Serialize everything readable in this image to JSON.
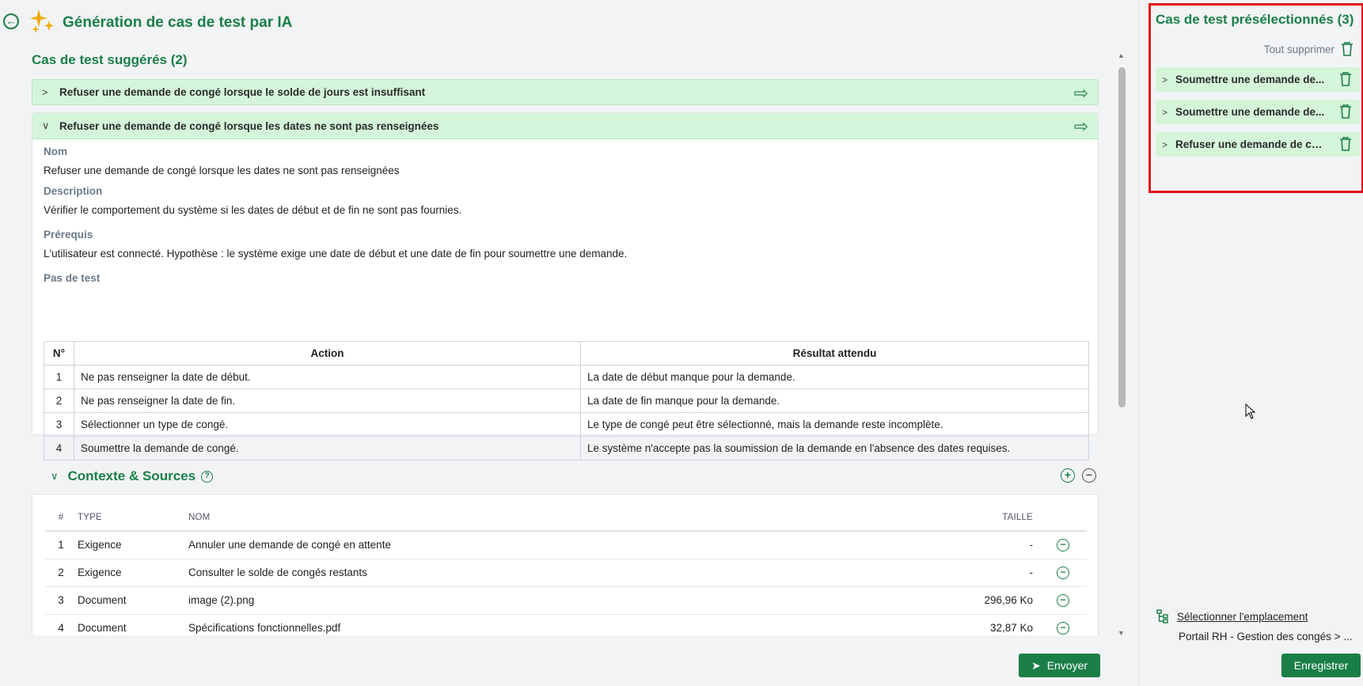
{
  "header": {
    "title": "Génération de cas de test par IA",
    "back_icon": "arrow-left-circle-icon",
    "logo_icon": "sparkle-stars-icon"
  },
  "suggested": {
    "title": "Cas de test suggérés (2)",
    "items": [
      {
        "label": "Refuser une demande de congé lorsque le solde de jours est insuffisant",
        "expanded": false
      },
      {
        "label": "Refuser une demande de congé lorsque les dates ne sont pas renseignées",
        "expanded": true
      }
    ],
    "detail": {
      "name_label": "Nom",
      "name_value": "Refuser une demande de congé lorsque les dates ne sont pas renseignées",
      "description_label": "Description",
      "description_value": "Vérifier le comportement du système si les dates de début et de fin ne sont pas fournies.",
      "prereq_label": "Prérequis",
      "prereq_value": "L'utilisateur est connecté. Hypothèse : le système exige une date de début et une date de fin pour soumettre une demande.",
      "steps_label": "Pas de test",
      "steps_headers": [
        "N°",
        "Action",
        "Résultat attendu"
      ],
      "steps": [
        {
          "n": "1",
          "action": "Ne pas renseigner la date de début.",
          "result": "La date de début manque pour la demande."
        },
        {
          "n": "2",
          "action": "Ne pas renseigner la date de fin.",
          "result": "La date de fin manque pour la demande."
        },
        {
          "n": "3",
          "action": "Sélectionner un type de congé.",
          "result": "Le type de congé peut être sélectionné, mais la demande reste incomplète."
        },
        {
          "n": "4",
          "action": "Soumettre la demande de congé.",
          "result": "Le système n'accepte pas la soumission de la demande en l'absence des dates requises."
        }
      ]
    }
  },
  "context": {
    "title": "Contexte & Sources",
    "headers": [
      "#",
      "TYPE",
      "NOM",
      "TAILLE"
    ],
    "rows": [
      {
        "n": "1",
        "type": "Exigence",
        "name": "Annuler une demande de congé en attente",
        "size": "-"
      },
      {
        "n": "2",
        "type": "Exigence",
        "name": "Consulter le solde de congés restants",
        "size": "-"
      },
      {
        "n": "3",
        "type": "Document",
        "name": "image (2).png",
        "size": "296,96 Ko"
      },
      {
        "n": "4",
        "type": "Document",
        "name": "Spécifications fonctionnelles.pdf",
        "size": "32,87 Ko"
      }
    ]
  },
  "send_button": "Envoyer",
  "preselected": {
    "title": "Cas de test présélectionnés (3)",
    "clear_all": "Tout supprimer",
    "items": [
      "Soumettre une demande de...",
      "Soumettre une demande de...",
      "Refuser une demande de co..."
    ]
  },
  "location": {
    "link": "Sélectionner l'emplacement",
    "path": "Portail RH - Gestion des congés > ..."
  },
  "save_button": "Enregistrer",
  "colors": {
    "accent": "#1a7f47",
    "highlight_border": "#e0141c",
    "item_bg": "#d4f5d9"
  }
}
